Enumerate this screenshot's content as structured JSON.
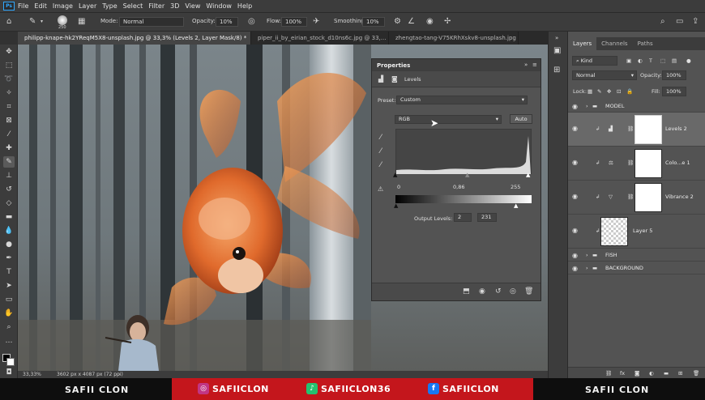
{
  "menu": [
    "File",
    "Edit",
    "Image",
    "Layer",
    "Type",
    "Select",
    "Filter",
    "3D",
    "View",
    "Window",
    "Help"
  ],
  "options": {
    "brush_size": "250",
    "mode_label": "Mode:",
    "mode_value": "Normal",
    "opacity_label": "Opacity:",
    "opacity_value": "10%",
    "flow_label": "Flow:",
    "flow_value": "100%",
    "smoothing_label": "Smoothing:",
    "smoothing_value": "10%"
  },
  "tabs": [
    "philipp-knape-hk2YReqM5X8-unsplash.jpg @ 33,3% (Levels 2, Layer Mask/8) *",
    "piper_ii_by_eirian_stock_d10ns6c.jpg @ 33,...",
    "zhengtao-tang-V75KRhXskv8-unsplash.jpg"
  ],
  "status": {
    "zoom": "33,33%",
    "size": "3602 px x 4087 px (72 ppi)"
  },
  "properties": {
    "title": "Properties",
    "adjustment": "Levels",
    "preset_label": "Preset:",
    "preset_value": "Custom",
    "channel": "RGB",
    "auto_label": "Auto",
    "input_black": "0",
    "input_gamma": "0,86",
    "input_white": "255",
    "output_label": "Output Levels:",
    "output_black": "2",
    "output_white": "231"
  },
  "layers_panel": {
    "tabs": [
      "Layers",
      "Channels",
      "Paths"
    ],
    "kind": "Kind",
    "blend": "Normal",
    "opacity_label": "Opacity:",
    "opacity_value": "100%",
    "lock_label": "Lock:",
    "fill_label": "Fill:",
    "fill_value": "100%",
    "layers": [
      {
        "name": "MODEL",
        "type": "group"
      },
      {
        "name": "Levels 2",
        "type": "adjustment",
        "selected": true
      },
      {
        "name": "Colo...e 1",
        "type": "adjustment"
      },
      {
        "name": "Vibrance 2",
        "type": "adjustment"
      },
      {
        "name": "Layer 5",
        "type": "pixel"
      },
      {
        "name": "FISH",
        "type": "group"
      },
      {
        "name": "BACKGROUND",
        "type": "group"
      }
    ]
  },
  "banner": {
    "left": "SAFII CLON",
    "instagram": "SAFIICLON",
    "tiktok": "SAFIICLON36",
    "facebook": "SAFIICLON",
    "right": "SAFII CLON"
  },
  "colors": {
    "accent_red": "#c4161c",
    "instagram": "#c13584",
    "tiktok": "#25c16f",
    "facebook": "#1877f2"
  }
}
